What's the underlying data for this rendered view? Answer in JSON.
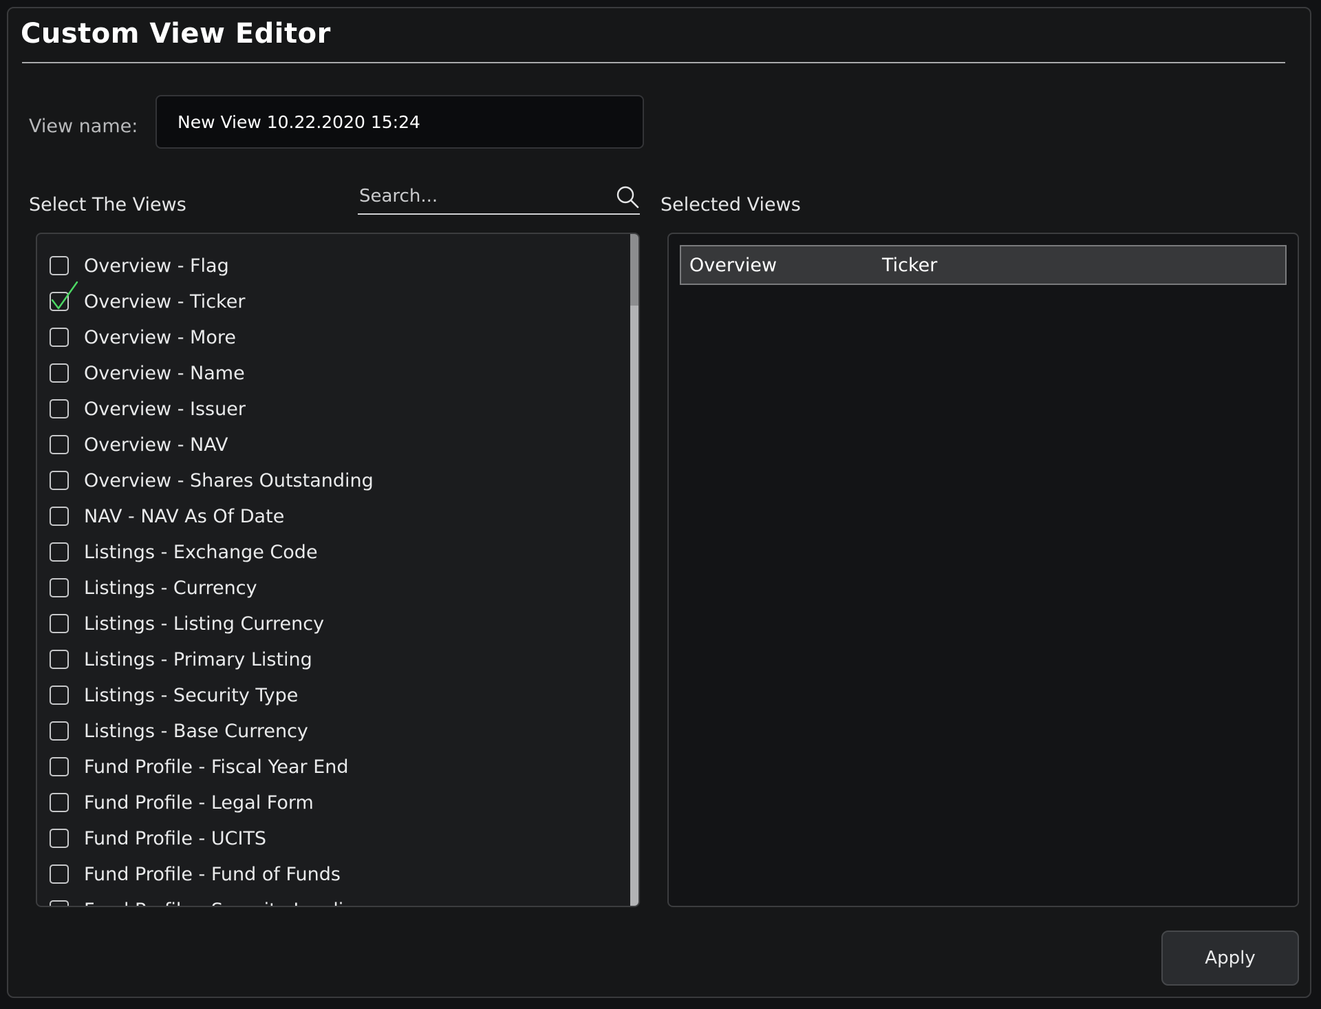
{
  "dialog": {
    "title": "Custom View Editor"
  },
  "view_name": {
    "label": "View name:",
    "value": "New View 10.22.2020 15:24"
  },
  "select_views": {
    "label": "Select The Views",
    "search_placeholder": "Search...",
    "items": [
      {
        "label": "Overview - Flag",
        "checked": false
      },
      {
        "label": "Overview - Ticker",
        "checked": true
      },
      {
        "label": "Overview - More",
        "checked": false
      },
      {
        "label": "Overview - Name",
        "checked": false
      },
      {
        "label": "Overview - Issuer",
        "checked": false
      },
      {
        "label": "Overview - NAV",
        "checked": false
      },
      {
        "label": "Overview - Shares Outstanding",
        "checked": false
      },
      {
        "label": "NAV - NAV As Of Date",
        "checked": false
      },
      {
        "label": "Listings - Exchange Code",
        "checked": false
      },
      {
        "label": "Listings - Currency",
        "checked": false
      },
      {
        "label": "Listings - Listing Currency",
        "checked": false
      },
      {
        "label": "Listings - Primary Listing",
        "checked": false
      },
      {
        "label": "Listings - Security Type",
        "checked": false
      },
      {
        "label": "Listings - Base Currency",
        "checked": false
      },
      {
        "label": "Fund Profile - Fiscal Year End",
        "checked": false
      },
      {
        "label": "Fund Profile - Legal Form",
        "checked": false
      },
      {
        "label": "Fund Profile - UCITS",
        "checked": false
      },
      {
        "label": "Fund Profile - Fund of Funds",
        "checked": false
      },
      {
        "label": "Fund Profile - Security Lending",
        "checked": false
      }
    ]
  },
  "selected_views": {
    "label": "Selected Views",
    "rows": [
      {
        "category": "Overview",
        "field": "Ticker"
      }
    ]
  },
  "actions": {
    "apply_label": "Apply"
  },
  "colors": {
    "check_mark": "#4cd964",
    "panel_border": "#3c3d3f"
  }
}
